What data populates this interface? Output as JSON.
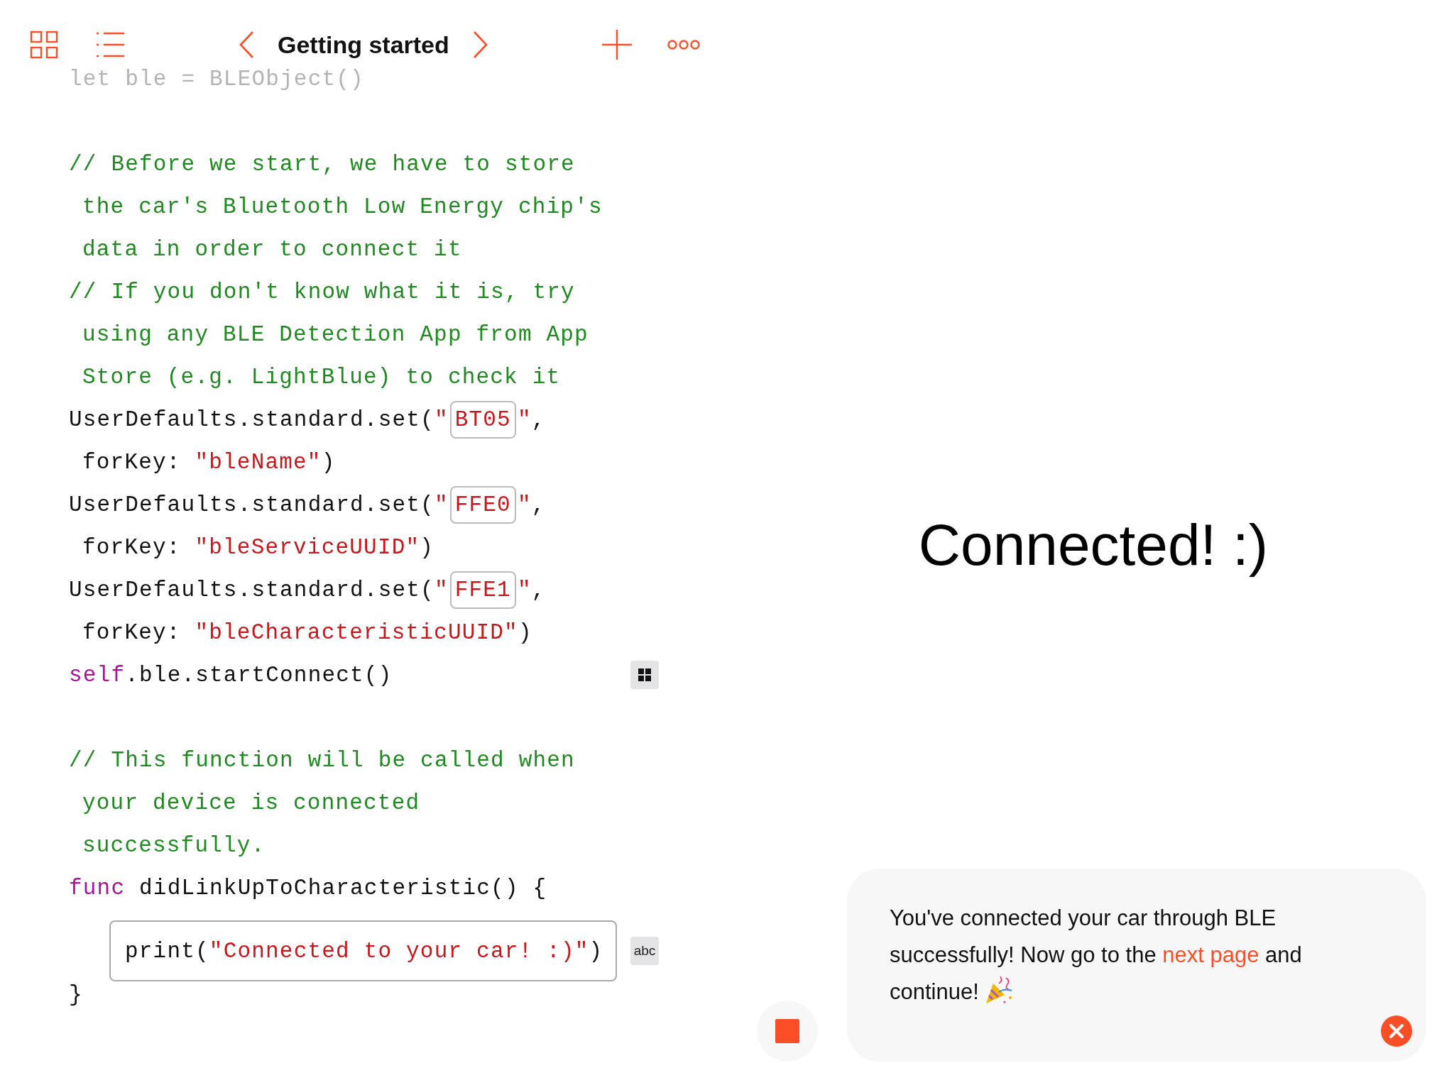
{
  "toolbar": {
    "title": "Getting started"
  },
  "code": {
    "lines": [
      {
        "kind": "faded",
        "tokens": [
          {
            "kind": "plain",
            "text": "let ble = BLEObject()"
          }
        ]
      },
      {
        "kind": "blank"
      },
      {
        "kind": "code",
        "wrapped": false,
        "tokens": [
          {
            "kind": "comment",
            "text": "// Before we start, we have to store"
          }
        ]
      },
      {
        "kind": "code",
        "wrapped": true,
        "tokens": [
          {
            "kind": "comment",
            "text": "the car's Bluetooth Low Energy chip's"
          }
        ]
      },
      {
        "kind": "code",
        "wrapped": true,
        "tokens": [
          {
            "kind": "comment",
            "text": "data in order to connect it"
          }
        ]
      },
      {
        "kind": "code",
        "wrapped": false,
        "tokens": [
          {
            "kind": "comment",
            "text": "// If you don't know what it is, try"
          }
        ]
      },
      {
        "kind": "code",
        "wrapped": true,
        "tokens": [
          {
            "kind": "comment",
            "text": "using any BLE Detection App from App"
          }
        ]
      },
      {
        "kind": "code",
        "wrapped": true,
        "tokens": [
          {
            "kind": "comment",
            "text": "Store (e.g. LightBlue) to check it"
          }
        ]
      },
      {
        "kind": "code",
        "wrapped": false,
        "tokens": [
          {
            "kind": "plain",
            "text": "UserDefaults.standard.set("
          },
          {
            "kind": "string",
            "text": "\""
          },
          {
            "kind": "placeholder",
            "text": "BT05"
          },
          {
            "kind": "string",
            "text": "\""
          },
          {
            "kind": "plain",
            "text": ","
          }
        ]
      },
      {
        "kind": "code",
        "wrapped": true,
        "tokens": [
          {
            "kind": "plain",
            "text": "forKey: "
          },
          {
            "kind": "string",
            "text": "\"bleName\""
          },
          {
            "kind": "plain",
            "text": ")"
          }
        ]
      },
      {
        "kind": "code",
        "wrapped": false,
        "tokens": [
          {
            "kind": "plain",
            "text": "UserDefaults.standard.set("
          },
          {
            "kind": "string",
            "text": "\""
          },
          {
            "kind": "placeholder",
            "text": "FFE0"
          },
          {
            "kind": "string",
            "text": "\""
          },
          {
            "kind": "plain",
            "text": ","
          }
        ]
      },
      {
        "kind": "code",
        "wrapped": true,
        "tokens": [
          {
            "kind": "plain",
            "text": "forKey: "
          },
          {
            "kind": "string",
            "text": "\"bleServiceUUID\""
          },
          {
            "kind": "plain",
            "text": ")"
          }
        ]
      },
      {
        "kind": "code",
        "wrapped": false,
        "tokens": [
          {
            "kind": "plain",
            "text": "UserDefaults.standard.set("
          },
          {
            "kind": "string",
            "text": "\""
          },
          {
            "kind": "placeholder",
            "text": "FFE1"
          },
          {
            "kind": "string",
            "text": "\""
          },
          {
            "kind": "plain",
            "text": ","
          }
        ]
      },
      {
        "kind": "code",
        "wrapped": true,
        "tokens": [
          {
            "kind": "plain",
            "text": "forKey: "
          },
          {
            "kind": "string",
            "text": "\"bleCharacteristicUUID\""
          },
          {
            "kind": "plain",
            "text": ")"
          }
        ]
      },
      {
        "kind": "code",
        "wrapped": false,
        "options_button": true,
        "tokens": [
          {
            "kind": "keyword",
            "text": "self"
          },
          {
            "kind": "plain",
            "text": ".ble.startConnect()"
          }
        ]
      },
      {
        "kind": "blank"
      },
      {
        "kind": "code",
        "wrapped": false,
        "tokens": [
          {
            "kind": "comment",
            "text": "// This function will be called when"
          }
        ]
      },
      {
        "kind": "code",
        "wrapped": true,
        "tokens": [
          {
            "kind": "comment",
            "text": "your device is connected"
          }
        ]
      },
      {
        "kind": "code",
        "wrapped": true,
        "tokens": [
          {
            "kind": "comment",
            "text": "successfully."
          }
        ]
      },
      {
        "kind": "code",
        "wrapped": false,
        "tokens": [
          {
            "kind": "keyword",
            "text": "func"
          },
          {
            "kind": "plain",
            "text": " didLinkUpToCharacteristic() {"
          }
        ]
      },
      {
        "kind": "editable",
        "accessory_text": "abc",
        "tokens": [
          {
            "kind": "plain",
            "text": "print("
          },
          {
            "kind": "string",
            "text": "\"Connected to your car! :)\""
          },
          {
            "kind": "plain",
            "text": ")"
          }
        ]
      },
      {
        "kind": "close",
        "tokens": [
          {
            "kind": "plain",
            "text": "}"
          }
        ]
      }
    ]
  },
  "live_view": {
    "heading": "Connected! :)"
  },
  "message": {
    "text": "You've connected your car through BLE successfully! Now go to the ",
    "link": "next page",
    "text_after": " and continue!"
  }
}
